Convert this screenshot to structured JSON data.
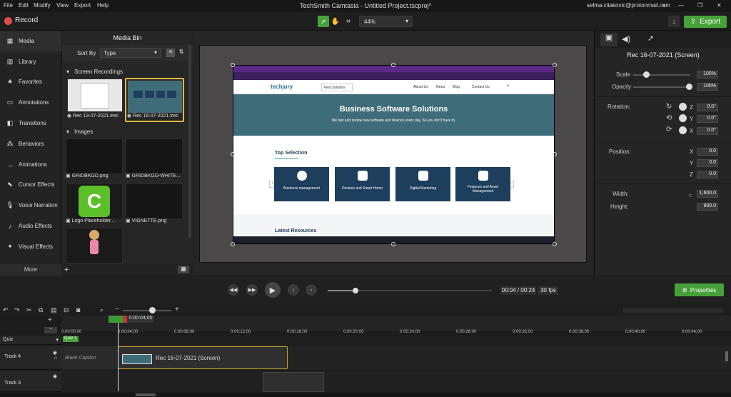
{
  "menu": [
    "File",
    "Edit",
    "Modify",
    "View",
    "Export",
    "Help"
  ],
  "window_title": "TechSmith Camtasia - Untitled Project.tscproj*",
  "user_email": "selma.citakovic@protonmail.com",
  "record_label": "Record",
  "zoom_value": "44%",
  "export_label": "Export",
  "nav": [
    "Media",
    "Library",
    "Favorites",
    "Annotations",
    "Transitions",
    "Behaviors",
    "Animations",
    "Cursor Effects",
    "Voice Narration",
    "Audio Effects",
    "Visual Effects"
  ],
  "more_label": "More",
  "media_bin": {
    "title": "Media Bin",
    "sort_by_label": "Sort By",
    "sort_value": "Type",
    "section_recordings": "Screen Recordings",
    "recordings": [
      "Rec 13-07-2021.trec",
      "Rec 16-07-2021.trec"
    ],
    "section_images": "Images",
    "images": [
      "GRIDBKGD.png",
      "GRIDBKGD-WHITE...",
      "Logo Placeholder....",
      "VIGNETTE.png"
    ]
  },
  "screen": {
    "logo_text": "techjury",
    "find_solution": "Find Solution",
    "nav_links": [
      "About Us",
      "News",
      "Blog",
      "Contact Us"
    ],
    "hero_title": "Business Software Solutions",
    "hero_sub": "We test and review new software and devices every day. So you don't have to.",
    "top_selection": "Top Selection",
    "cards": [
      "Business management",
      "Devices and Smart Home",
      "Digital Marketing",
      "Finances and Asset Management"
    ],
    "latest": "Latest Resources"
  },
  "props": {
    "title": "Rec 16-07-2021 (Screen)",
    "scale_label": "Scale",
    "scale_value": "100%",
    "opacity_label": "Opacity",
    "opacity_value": "100%",
    "rotation_label": "Rotation:",
    "rot_z": "0.0°",
    "rot_y": "0.0°",
    "rot_x": "0.0°",
    "position_label": "Position:",
    "pos_x": "0.0",
    "pos_y": "0.0",
    "pos_z": "0.0",
    "width_label": "Width:",
    "width_value": "1,600.0",
    "height_label": "Height:",
    "height_value": "900.0",
    "axis_z": "Z",
    "axis_y": "Y",
    "axis_x": "X"
  },
  "playback": {
    "time": "00:04 / 00:24",
    "fps": "30 fps",
    "progress": 0.17,
    "properties_label": "Properties"
  },
  "timeline": {
    "playhead_time": "0:00:04;00",
    "ticks": [
      "0:00:00;00",
      "0:00:04;00",
      "0:00:08;00",
      "0:00:12;00",
      "0:00:16;00",
      "0:00:20;00",
      "0:00:24;00",
      "0:00:28;00",
      "0:00:32;00",
      "0:00:36;00",
      "0:00:40;00",
      "0:00:44;00"
    ],
    "quiz_label": "Quiz",
    "quiz_marker": "Quiz 1",
    "track4": "Track 4",
    "track3": "Track 3",
    "blank_caption": "Blank Caption",
    "clip_label": "Rec 16-07-2021 (Screen)"
  },
  "colors": {
    "accent_green": "#47a13a",
    "record_red": "#e24a4a",
    "hero_bg": "#3f6c79",
    "card_bg": "#1d3e5c"
  }
}
